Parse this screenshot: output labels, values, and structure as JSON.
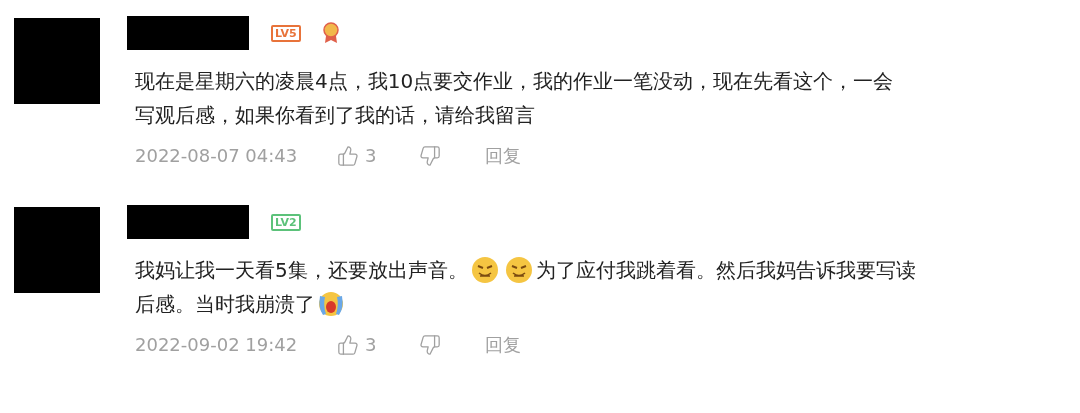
{
  "comments": [
    {
      "level_badge": {
        "label": "LV5",
        "color": "#e8733a"
      },
      "medal": true,
      "lines": [
        [
          {
            "kind": "text",
            "text": "现在是星期六的凌晨4点，我10点要交作业，我的作业一笔没动，现在先看这个，一会"
          }
        ],
        [
          {
            "kind": "text",
            "text": "写观后感，如果你看到了我的话，请给我留言"
          }
        ]
      ],
      "date": "2022-08-07 04:43",
      "likes": "3",
      "reply": "回复"
    },
    {
      "level_badge": {
        "label": "LV2",
        "color": "#5cc27a"
      },
      "medal": false,
      "lines": [
        [
          {
            "kind": "text",
            "text": "我妈让我一天看5集，还要放出声音。"
          },
          {
            "kind": "grimace"
          },
          {
            "kind": "grimace"
          },
          {
            "kind": "text",
            "text": "为了应付我跳着看。然后我妈告诉我要写读"
          }
        ],
        [
          {
            "kind": "text",
            "text": "后感。当时我崩溃了"
          },
          {
            "kind": "crying"
          }
        ]
      ],
      "date": "2022-09-02 19:42",
      "likes": "3",
      "reply": "回复"
    }
  ]
}
